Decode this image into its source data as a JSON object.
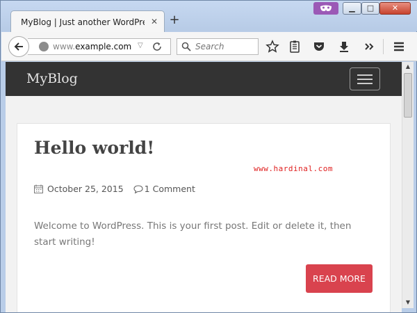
{
  "browser": {
    "tab_title": "MyBlog | Just another WordPre...",
    "url_prefix": "www.",
    "url_domain": "example.com",
    "search_placeholder": "Search"
  },
  "site": {
    "title": "MyBlog"
  },
  "post": {
    "title": "Hello world!",
    "watermark": "www.hardinal.com",
    "date": "October 25, 2015",
    "comments": "1 Comment",
    "excerpt": "Welcome to WordPress. This is your first post. Edit or delete it, then start writing!",
    "read_more": "READ MORE"
  },
  "colors": {
    "header_bg": "#333333",
    "accent": "#d9434e",
    "watermark": "#e02020"
  }
}
